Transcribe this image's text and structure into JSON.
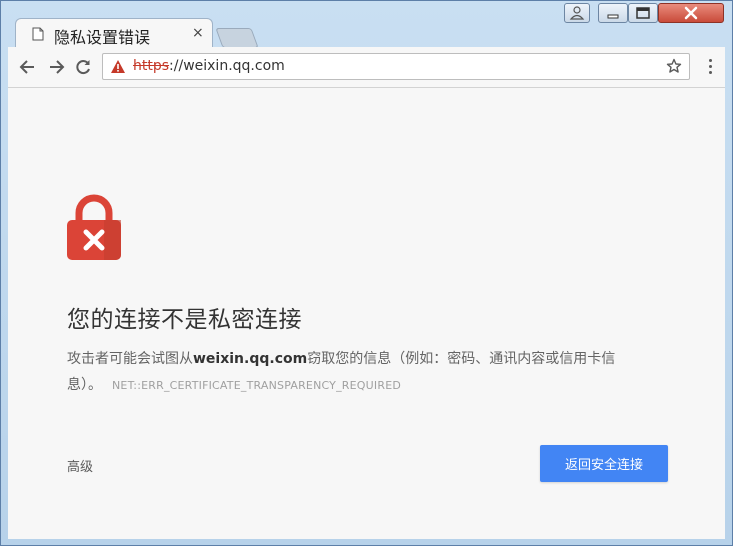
{
  "tab": {
    "title": "隐私设置错误",
    "close": "×",
    "favicon": "page-icon"
  },
  "address_bar": {
    "scheme": "https",
    "rest": "://weixin.qq.com",
    "security_state": "not-secure-warning",
    "warning_color": "#c53929"
  },
  "page": {
    "heading": "您的连接不是私密连接",
    "desc_pre": "攻击者可能会试图从",
    "desc_domain": "weixin.qq.com",
    "desc_post": "窃取您的信息（例如：密码、通讯内容或信用卡信息）。",
    "error_code": "NET::ERR_CERTIFICATE_TRANSPARENCY_REQUIRED",
    "advanced_label": "高级",
    "back_button_label": "返回安全连接",
    "accent_color": "#4285f4",
    "lock_color": "#db4437"
  }
}
